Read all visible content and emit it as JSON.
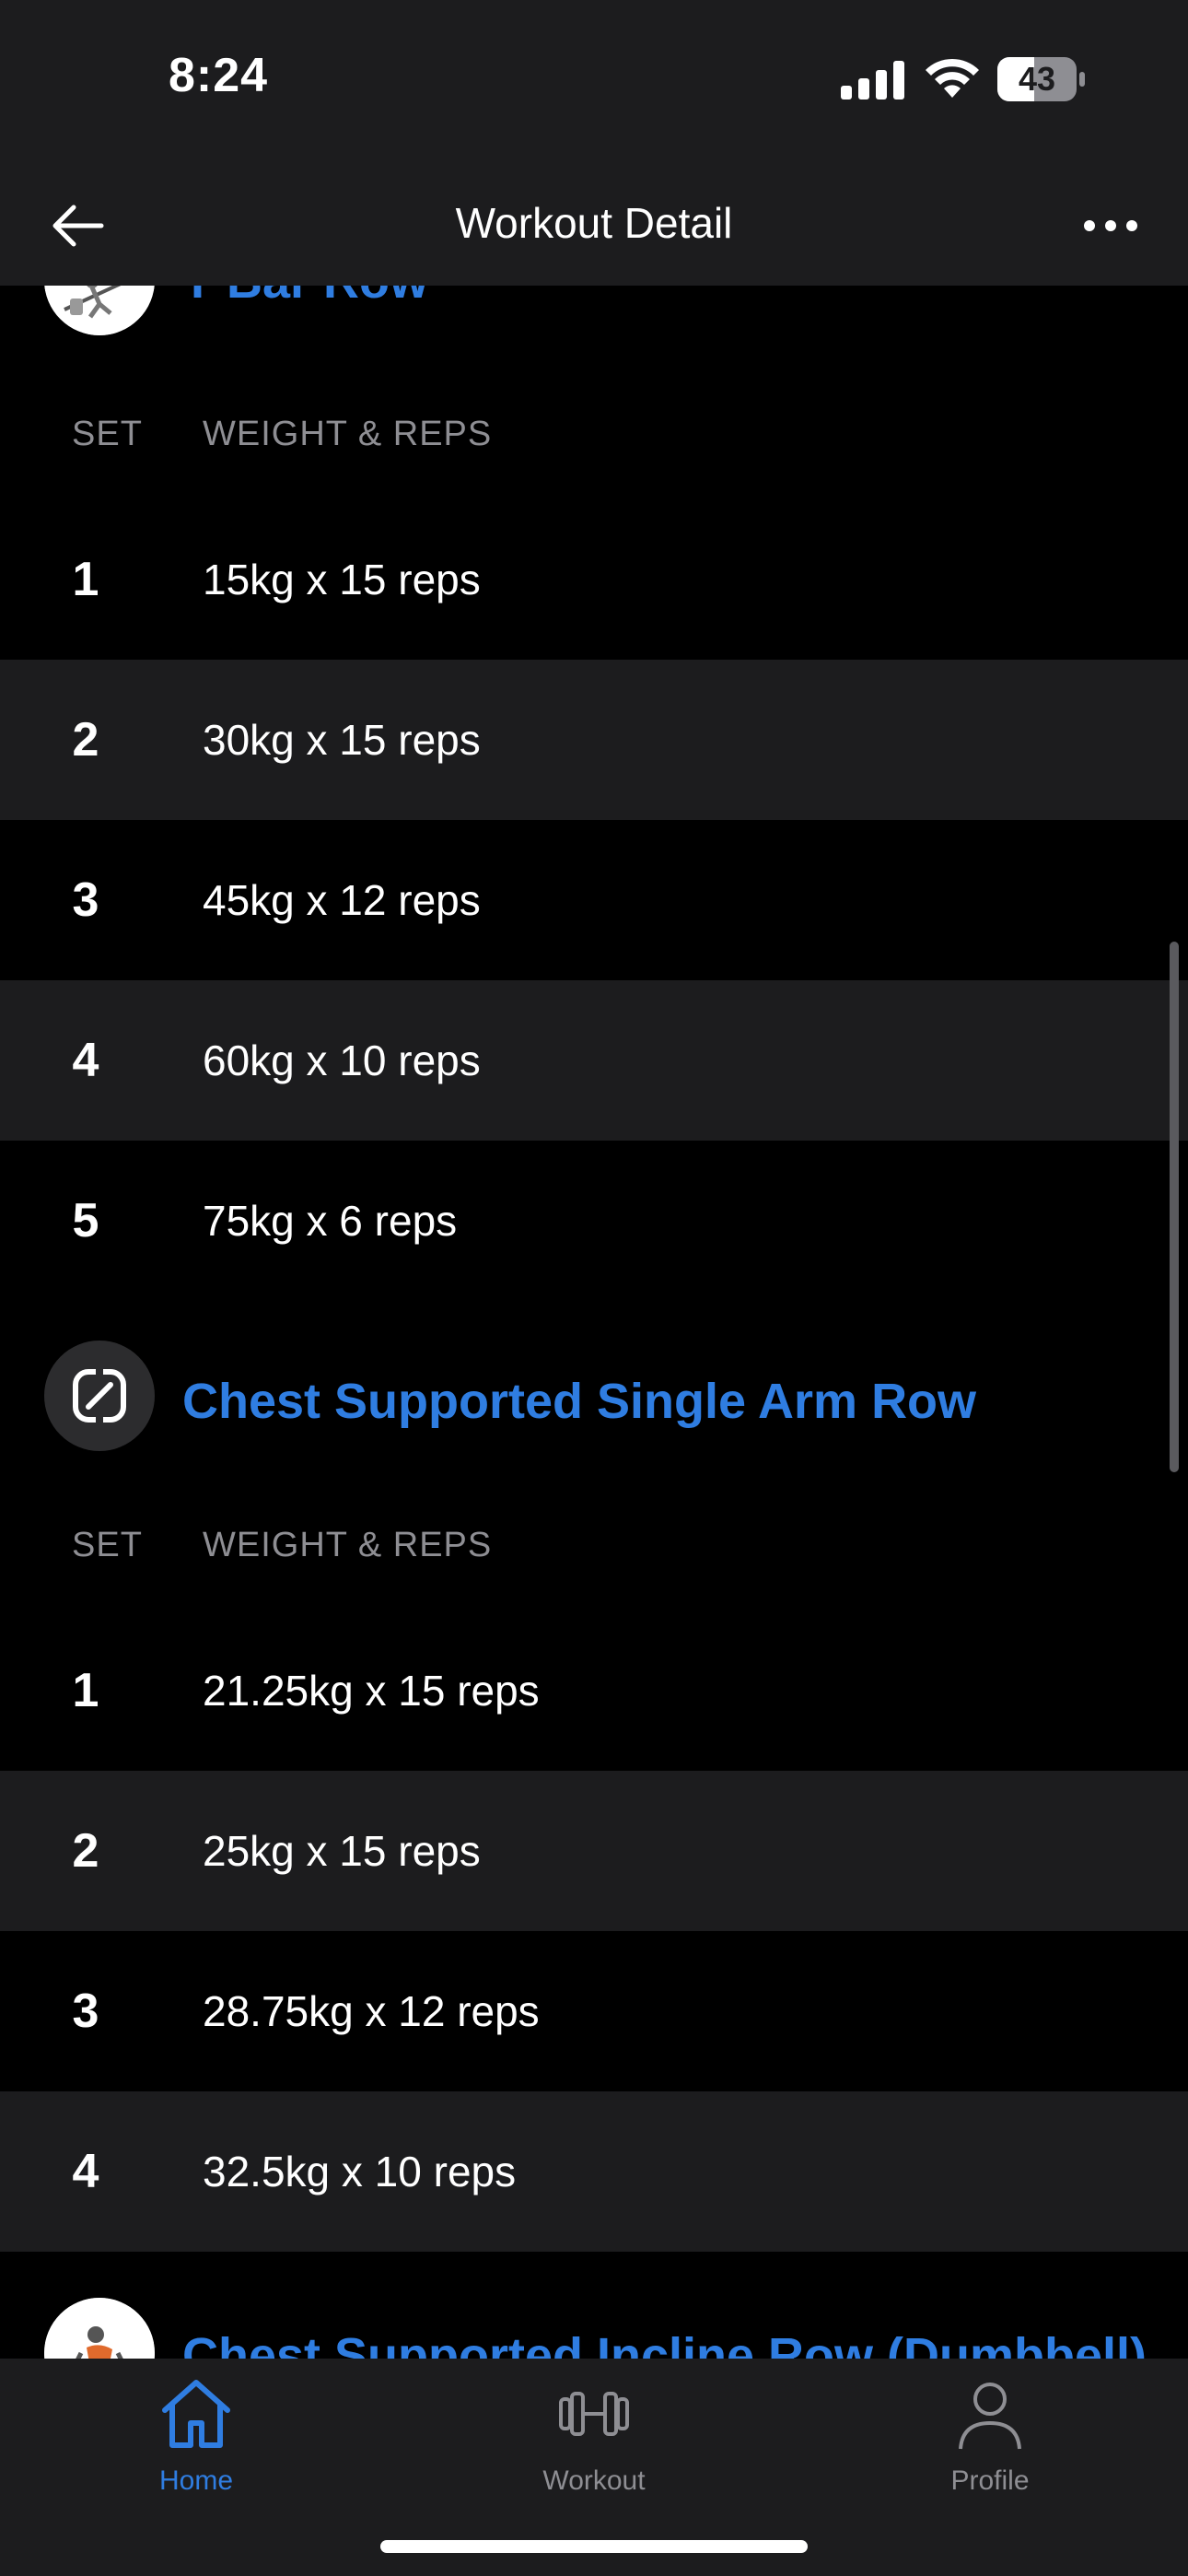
{
  "status_bar": {
    "time": "8:24",
    "battery_level": "43"
  },
  "nav": {
    "title": "Workout Detail",
    "back_icon": "arrow-left-icon",
    "more_icon": "ellipsis-icon"
  },
  "exercises": [
    {
      "name": "T Bar Row",
      "set_header": "SET",
      "weight_header": "WEIGHT & REPS",
      "sets": [
        {
          "num": "1",
          "value": "15kg x 15 reps"
        },
        {
          "num": "2",
          "value": "30kg x 15 reps"
        },
        {
          "num": "3",
          "value": "45kg x 12 reps"
        },
        {
          "num": "4",
          "value": "60kg x 10 reps"
        },
        {
          "num": "5",
          "value": "75kg x 6 reps"
        }
      ]
    },
    {
      "name": "Chest Supported Single Arm Row",
      "set_header": "SET",
      "weight_header": "WEIGHT & REPS",
      "sets": [
        {
          "num": "1",
          "value": "21.25kg x 15 reps"
        },
        {
          "num": "2",
          "value": "25kg x 15 reps"
        },
        {
          "num": "3",
          "value": "28.75kg x 12 reps"
        },
        {
          "num": "4",
          "value": "32.5kg x 10 reps"
        }
      ]
    },
    {
      "name": "Chest Supported Incline Row (Dumbbell)"
    }
  ],
  "tab_bar": {
    "tabs": [
      {
        "label": "Home",
        "icon": "home-icon",
        "active": true
      },
      {
        "label": "Workout",
        "icon": "dumbbell-icon",
        "active": false
      },
      {
        "label": "Profile",
        "icon": "person-icon",
        "active": false
      }
    ]
  },
  "colors": {
    "accent": "#2f7de1",
    "background": "#000000",
    "surface": "#1c1c1e",
    "muted_text": "#8e8e93"
  }
}
